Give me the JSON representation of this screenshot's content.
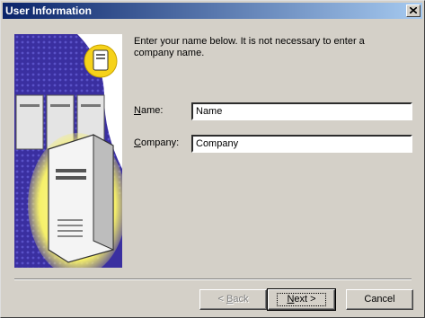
{
  "window": {
    "title": "User Information"
  },
  "intro_text": "Enter your name below.  It is not necessary to enter a company name.",
  "form": {
    "name": {
      "label_underlined": "N",
      "label_rest": "ame:",
      "value": "Name"
    },
    "company": {
      "label_underlined": "C",
      "label_rest": "ompany:",
      "value": "Company"
    }
  },
  "buttons": {
    "back": {
      "prefix": "< ",
      "underlined": "B",
      "rest": "ack"
    },
    "next": {
      "underlined": "N",
      "rest": "ext >"
    },
    "cancel": "Cancel"
  },
  "icons": [
    "close-icon",
    "server-illustration",
    "database-icon"
  ],
  "colors": {
    "title_start": "#0a246a",
    "title_end": "#a6caf0",
    "panel_purple": "#3a2fa0",
    "glow_yellow": "#f6f06a"
  }
}
